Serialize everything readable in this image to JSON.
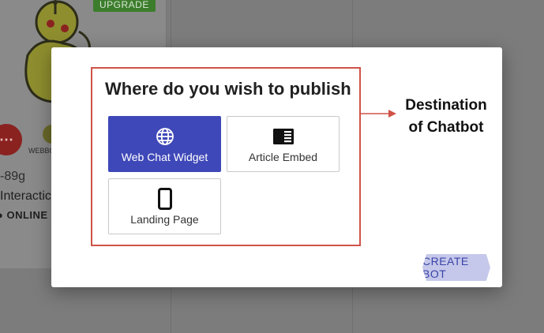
{
  "background": {
    "upgrade_label": "UPGRADE",
    "webbot_label": "WEBBO",
    "size_text": "-89g",
    "interaction_text": "Interactic",
    "status_text": "ONLINE",
    "chat_icon": "chat-bubble-icon"
  },
  "dialog": {
    "title": "Where do you wish to publish",
    "options": [
      {
        "label": "Web Chat Widget",
        "icon": "globe-icon",
        "selected": true
      },
      {
        "label": "Article Embed",
        "icon": "article-icon",
        "selected": false
      },
      {
        "label": "Landing Page",
        "icon": "phone-icon",
        "selected": false
      }
    ],
    "create_label": "CREATE BOT"
  },
  "annotation": {
    "caption_line1": "Destination",
    "caption_line2": "of Chatbot",
    "color": "#cf5248"
  },
  "colors": {
    "accent": "#3f48b8",
    "button_bg": "#c5c8ea",
    "button_text": "#3a43a8",
    "upgrade": "#3c7d2c",
    "overlay": "#7c7c7c"
  }
}
